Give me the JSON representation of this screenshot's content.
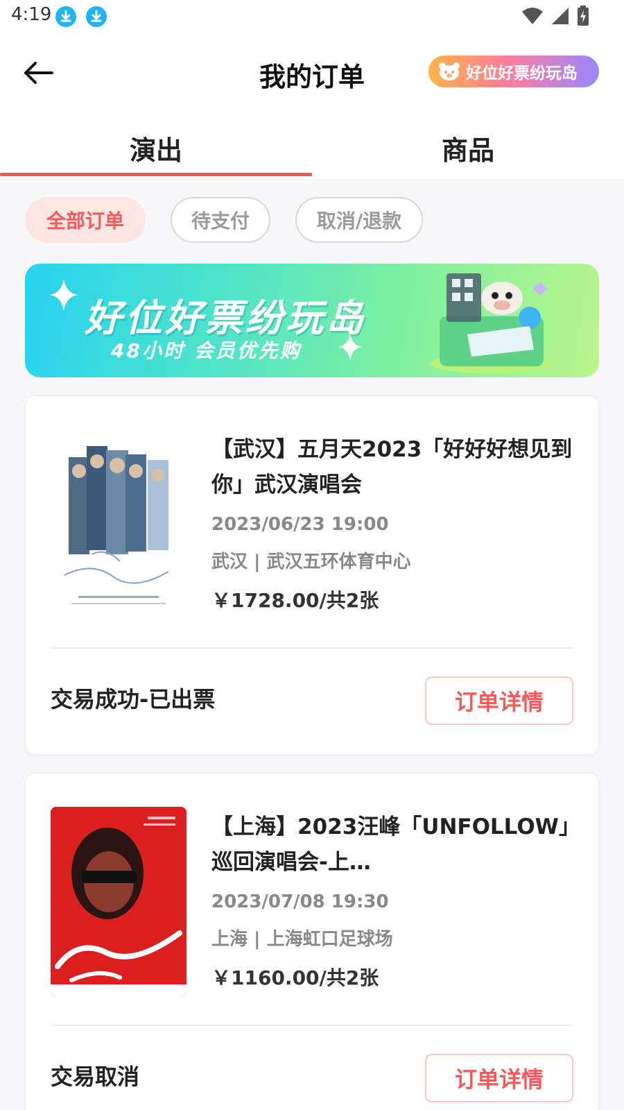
{
  "status_bar": {
    "time": "4:19"
  },
  "header": {
    "title": "我的订单",
    "promo_label": "好位好票纷玩岛"
  },
  "tabs": [
    {
      "label": "演出"
    },
    {
      "label": "商品"
    }
  ],
  "filters": [
    {
      "label": "全部订单"
    },
    {
      "label": "待支付"
    },
    {
      "label": "取消/退款"
    }
  ],
  "banner": {
    "title": "好位好票纷玩岛",
    "subtitle": "48小时 会员优先购"
  },
  "orders": [
    {
      "title": "【武汉】五月天2023「好好好想见到你」武汉演唱会",
      "time": "2023/06/23 19:00",
      "venue": "武汉 | 武汉五环体育中心",
      "price": "￥1728.00/共2张",
      "status": "交易成功-已出票",
      "detail_label": "订单详情"
    },
    {
      "title": "【上海】2023汪峰「UNFOLLOW」巡回演唱会-上…",
      "time": "2023/07/08 19:30",
      "venue": "上海 | 上海虹口足球场",
      "price": "￥1160.00/共2张",
      "status": "交易取消",
      "detail_label": "订单详情"
    }
  ],
  "colors": {
    "accent": "#f35a5a",
    "tab_underline": "#f2565d",
    "chip_active_bg": "#ffe4e4"
  },
  "icons": [
    "download-icon",
    "wifi-icon",
    "signal-icon",
    "battery-icon",
    "back-arrow-icon",
    "bear-icon"
  ]
}
